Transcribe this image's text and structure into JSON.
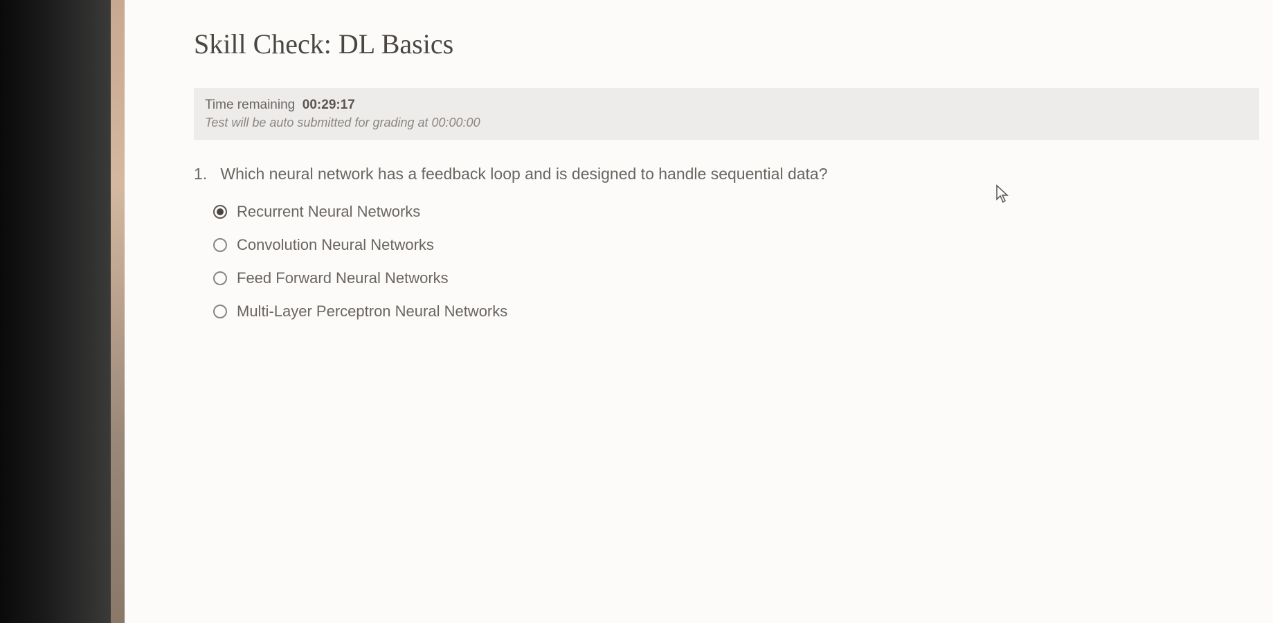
{
  "page": {
    "title": "Skill Check: DL Basics"
  },
  "timer": {
    "label": "Time remaining",
    "value": "00:29:17",
    "note": "Test will be auto submitted for grading at 00:00:00"
  },
  "question": {
    "number": "1.",
    "text": "Which neural network has a feedback loop and is designed to handle sequential data?",
    "options": [
      {
        "label": "Recurrent Neural Networks",
        "selected": true
      },
      {
        "label": "Convolution Neural Networks",
        "selected": false
      },
      {
        "label": "Feed Forward Neural Networks",
        "selected": false
      },
      {
        "label": "Multi-Layer Perceptron Neural Networks",
        "selected": false
      }
    ]
  }
}
